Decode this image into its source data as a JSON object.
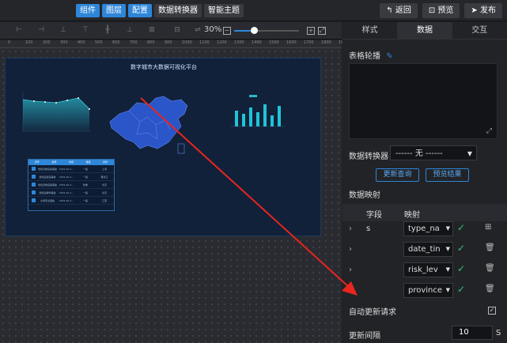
{
  "topbar": {
    "nav": [
      "组件",
      "图层",
      "配置",
      "数据转换器",
      "智能主题"
    ],
    "back_label": "返回",
    "preview_label": "预览",
    "publish_label": "发布"
  },
  "toolbar": {
    "zoom_label": "30%",
    "zoom_percent": 30
  },
  "ruler": {
    "marks": [
      "0",
      "100",
      "200",
      "300",
      "400",
      "500",
      "600",
      "700",
      "800",
      "900",
      "1000",
      "1100",
      "1200",
      "1300",
      "1400",
      "1500",
      "1600",
      "1700",
      "1800",
      "1900"
    ]
  },
  "screen": {
    "title": "数字城市大数据可视化平台",
    "table_headers": [
      "序号",
      "名称",
      "时间",
      "等级",
      "省份"
    ],
    "table_rows": [
      [
        "1",
        "危险货物运输事故",
        "2019-10-1...",
        "一般",
        "上海"
      ],
      [
        "2",
        "危险品泄露事故",
        "2019-10-1...",
        "一般",
        "黑龙江"
      ],
      [
        "3",
        "危险货物运输事故",
        "2019-10-1...",
        "较重",
        "北京"
      ],
      [
        "4",
        "危险品爆炸事故",
        "2019-10-1...",
        "一般",
        "北京"
      ],
      [
        "5",
        "交通安全事故",
        "2019-10-1...",
        "一般",
        "江西"
      ]
    ]
  },
  "panel": {
    "tabs": [
      "样式",
      "数据",
      "交互"
    ],
    "table_outline_label": "表格轮播",
    "converter_label": "数据转换器",
    "converter_value": "------ 无 ------",
    "refresh_query": "更新查询",
    "preview_result": "预览结果",
    "mapping_label": "数据映射",
    "field_header": "字段",
    "map_header": "映射",
    "rows": [
      {
        "field": "s",
        "value": "type_na"
      },
      {
        "field": "",
        "value": "date_tin"
      },
      {
        "field": "",
        "value": "risk_lev"
      },
      {
        "field": "",
        "value": "province"
      }
    ],
    "auto_update_label": "自动更新请求",
    "interval_label": "更新间隔",
    "interval_value": "10",
    "interval_unit": "S"
  }
}
